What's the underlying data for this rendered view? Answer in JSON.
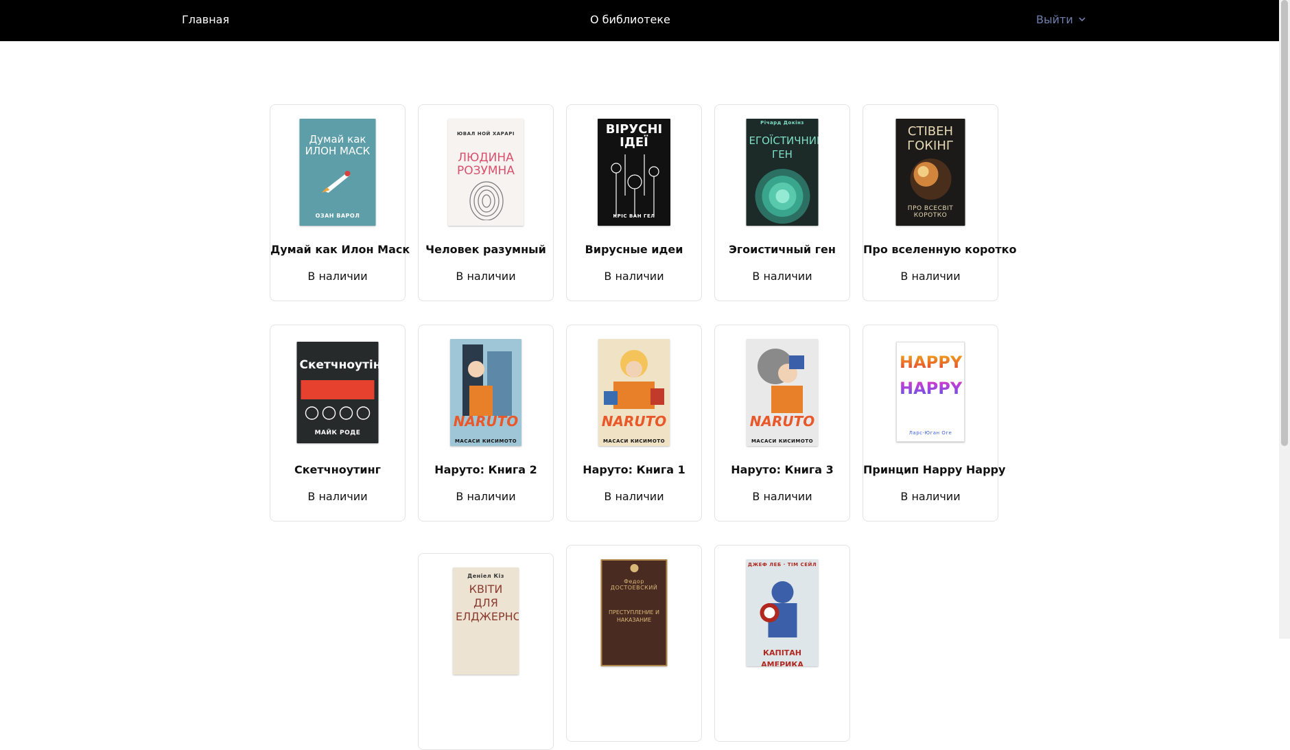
{
  "nav": {
    "home": "Главная",
    "about": "О библиотеке",
    "logout": "Выйти"
  },
  "books": [
    {
      "title": "Думай как Илон Маск",
      "status": "В наличии",
      "cover_title": "Думай как ИЛОН МАСК",
      "cover_author": "ОЗАН ВАРОЛ",
      "cover_bg": "#5e9ea9",
      "cover_fg": "#ffffff"
    },
    {
      "title": "Человек разумный",
      "status": "В наличии",
      "cover_title": "ЛЮДИНА РОЗУМНА",
      "cover_author": "ЮВАЛ НОЙ ХАРАРІ",
      "cover_bg": "#f6f3f1",
      "cover_fg": "#d9506d"
    },
    {
      "title": "Вирусные идеи",
      "status": "В наличии",
      "cover_title": "ВІРУСНІ ІДЕЇ",
      "cover_author": "КРІС ВАН ГЕЛ",
      "cover_bg": "#111111",
      "cover_fg": "#ffffff"
    },
    {
      "title": "Эгоистичный ген",
      "status": "В наличии",
      "cover_title": "ЕГОЇСТИЧНИЙ ГЕН",
      "cover_author": "Річард Докінз",
      "cover_bg": "#1c2a28",
      "cover_fg": "#7fe0c4"
    },
    {
      "title": "Про вселенную коротко",
      "status": "В наличии",
      "cover_title": "СТІВЕН ГОКІНГ",
      "cover_author": "ПРО ВСЕСВІТ КОРОТКО",
      "cover_bg": "#1b1a19",
      "cover_fg": "#e8d9b5"
    },
    {
      "title": "Скетчноутинг",
      "status": "В наличии",
      "cover_title": "Скетчноутінг",
      "cover_author": "МАЙК РОДЕ",
      "cover_bg": "#262a2b",
      "cover_fg": "#ffffff"
    },
    {
      "title": "Нарутo: Книга 2",
      "status": "В наличии",
      "cover_title": "NARUTO",
      "cover_author": "МАСАСИ КИСИМОТО",
      "cover_bg": "#9fc6d6",
      "cover_fg": "#e8582a"
    },
    {
      "title": "Нарутo: Книга 1",
      "status": "В наличии",
      "cover_title": "NARUTO",
      "cover_author": "МАСАСИ КИСИМОТО",
      "cover_bg": "#f0e3c5",
      "cover_fg": "#e8582a"
    },
    {
      "title": "Нарутo: Книга 3",
      "status": "В наличии",
      "cover_title": "NARUTO",
      "cover_author": "МАСАСИ КИСИМОТО",
      "cover_bg": "#e9e9e9",
      "cover_fg": "#e8582a"
    },
    {
      "title": "Принцип Happy Happy",
      "status": "В наличии",
      "cover_title": "HAPPY HAPPY",
      "cover_author": "Ларс-Юган Оге",
      "cover_bg": "#ffffff",
      "cover_fg": "#c23dd6"
    },
    {
      "title": "",
      "status": "",
      "cover_title": "КВІТИ ДЛЯ ЕЛДЖЕРНОНА",
      "cover_author": "Деніел Кіз",
      "cover_bg": "#ede3d3",
      "cover_fg": "#8a3b2e"
    },
    {
      "title": "",
      "status": "",
      "cover_title": "ПРЕСТУПЛЕНИЕ И НАКАЗАНИЕ",
      "cover_author": "Федор ДОСТОЕВСКИЙ",
      "cover_bg": "#4a2b22",
      "cover_fg": "#d8b878"
    },
    {
      "title": "",
      "status": "",
      "cover_title": "КАПІТАН АМЕРИКА",
      "cover_author": "ДЖЕФ ЛЕБ · ТІМ СЕЙЛ",
      "cover_bg": "#dfe6ea",
      "cover_fg": "#b0281f"
    }
  ]
}
